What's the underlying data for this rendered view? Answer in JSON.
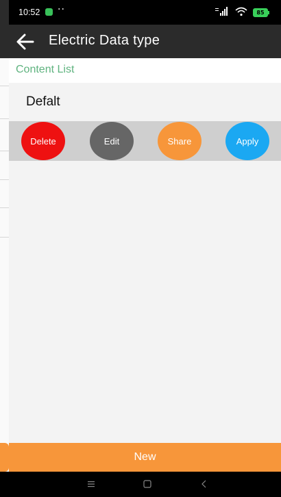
{
  "status_bar": {
    "time": "10:52",
    "dots": "··",
    "battery": "85",
    "icons": [
      "app-notification-icon",
      "signal-icon",
      "wifi-icon",
      "battery-icon"
    ]
  },
  "app_bar": {
    "title": "Electric Data type",
    "back_icon": "arrow-left-icon"
  },
  "section": {
    "title": "Content List"
  },
  "list": {
    "items": [
      {
        "label": "Defalt"
      }
    ]
  },
  "actions": {
    "delete_label": "Delete",
    "edit_label": "Edit",
    "share_label": "Share",
    "apply_label": "Apply"
  },
  "footer": {
    "new_label": "New"
  },
  "nav_bar": {
    "icons": [
      "menu-icon",
      "home-icon",
      "back-icon"
    ]
  },
  "colors": {
    "app_bar": "#2b2b2b",
    "section_title": "#5fb37f",
    "delete": "#ee1111",
    "edit": "#666666",
    "share": "#f7963a",
    "apply": "#1ba8f2",
    "new_button": "#f7963a"
  }
}
